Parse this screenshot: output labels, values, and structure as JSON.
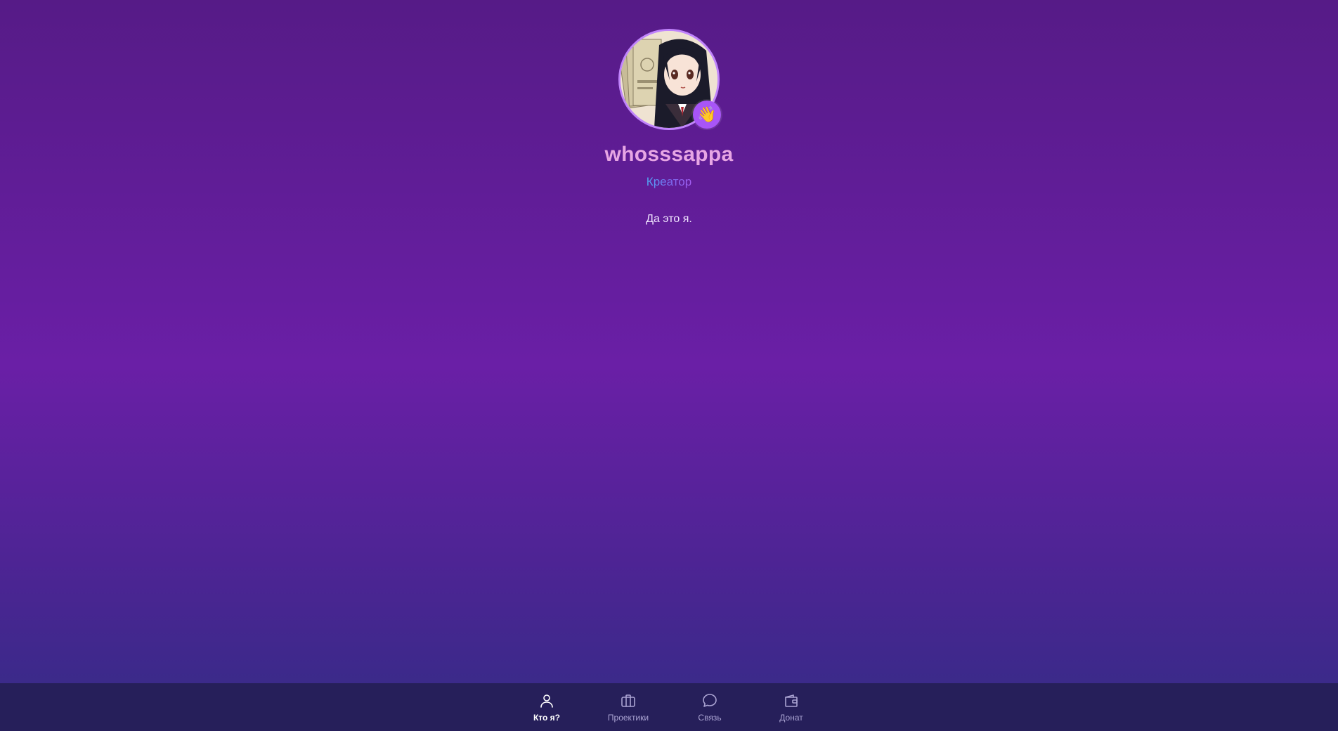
{
  "profile": {
    "username": "whosssappa",
    "role": "Креатор",
    "bio": "Да это я.",
    "badge_icon": "waving-hand-icon",
    "badge_glyph": "👋"
  },
  "nav": {
    "items": [
      {
        "label": "Кто я?",
        "icon": "user-icon",
        "active": true
      },
      {
        "label": "Проектики",
        "icon": "briefcase-icon",
        "active": false
      },
      {
        "label": "Связь",
        "icon": "chat-bubble-icon",
        "active": false
      },
      {
        "label": "Донат",
        "icon": "wallet-icon",
        "active": false
      }
    ]
  },
  "colors": {
    "accent": "#a855f7",
    "username": "#e7a6e4",
    "nav_background": "#261f5a"
  }
}
